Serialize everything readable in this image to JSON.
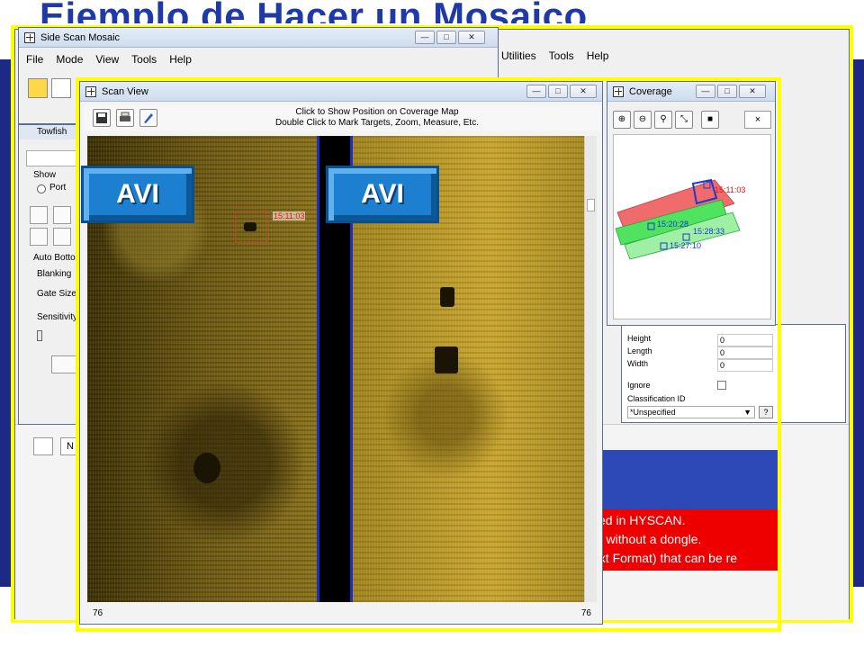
{
  "slide": {
    "title": "Ejemplo de Hacer un Mosaico",
    "accent_yellow": "#ffff00",
    "band_blue": "#2438a8"
  },
  "mosaic_window": {
    "title": "Side Scan Mosaic",
    "menu": [
      "File",
      "Mode",
      "View",
      "Tools",
      "Help"
    ],
    "right_menu": [
      "Utilities",
      "Tools",
      "Help"
    ]
  },
  "towfish_panel": {
    "title": "Towfish",
    "show_label": "Show",
    "port_label": "Port",
    "auto_bottom_label": "Auto Botto",
    "blanking_label": "Blanking",
    "gate_size_label": "Gate Size",
    "sensitivity_label": "Sensitivity"
  },
  "scan_view": {
    "title": "Scan View",
    "hint_line1": "Click to Show Position on Coverage Map",
    "hint_line2": "Double Click to Mark Targets, Zoom, Measure, Etc.",
    "marker_label": "15:11:03",
    "status_left": "76",
    "status_right": "76",
    "toolbar_icons": [
      "save-icon",
      "print-icon",
      "pen-icon"
    ]
  },
  "avi_buttons": [
    "AVI",
    "AVI"
  ],
  "coverage": {
    "title": "Coverage",
    "close_glyph": "×",
    "labels": [
      "15:11:03",
      "15:20:28",
      "15:28:33",
      "15:27:10"
    ],
    "track_red": "#f07070",
    "track_green": "#50e060",
    "toolbar_icons": [
      "zoom-in-icon",
      "zoom-out-icon",
      "zoom-fit-icon",
      "fullscreen-icon",
      "save-icon"
    ]
  },
  "properties": {
    "fields": [
      {
        "label": "Height",
        "value": "0"
      },
      {
        "label": "Length",
        "value": "0"
      },
      {
        "label": "Width",
        "value": "0"
      }
    ],
    "ignore_label": "Ignore",
    "classification_label": "Classification ID",
    "classification_value": "*Unspecified",
    "help_glyph": "?"
  },
  "notes": {
    "line1": "ked in HYSCAN.",
    "line2": "m without a dongle.",
    "line3": "ext Format) that can be re"
  }
}
